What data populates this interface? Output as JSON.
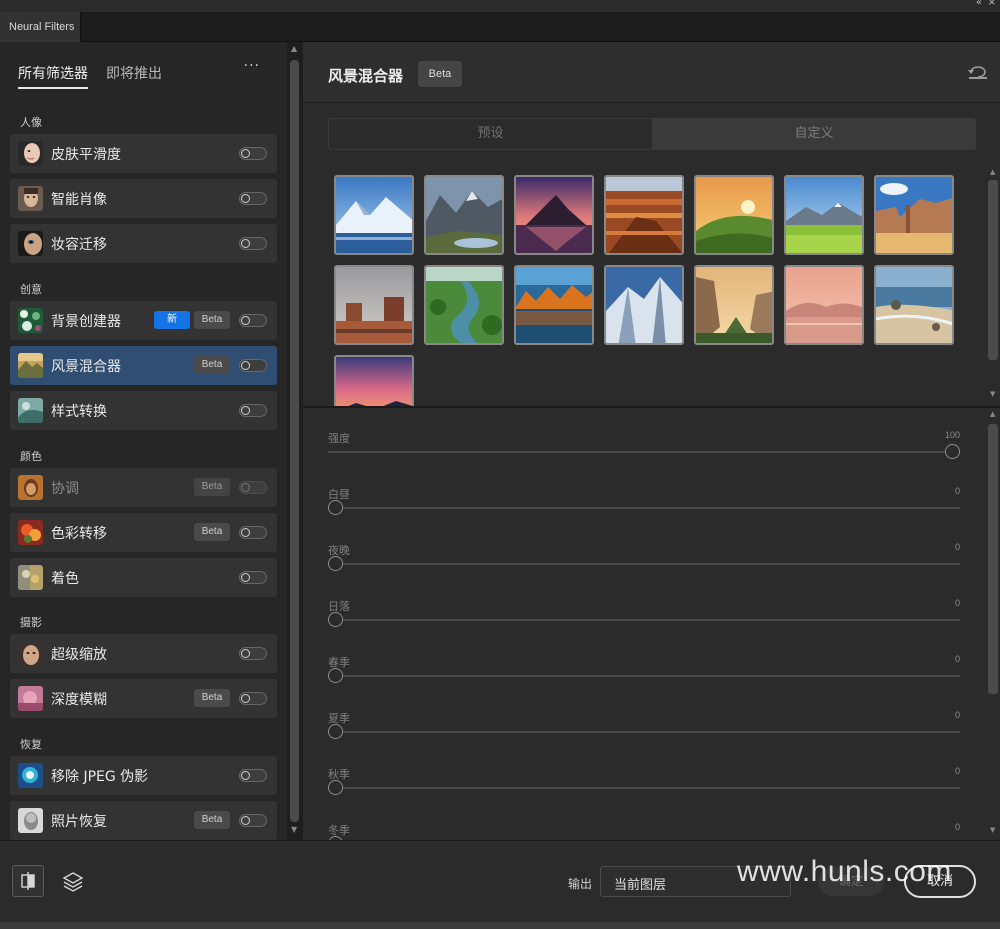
{
  "window": {
    "tab_title": "Neural Filters",
    "collapse_glyph": "«",
    "close_glyph": "×"
  },
  "left": {
    "tabs": [
      {
        "label": "所有筛选器"
      },
      {
        "label": "即将推出"
      }
    ],
    "more_glyph": "···",
    "sections": [
      {
        "label": "人像"
      },
      {
        "label": "创意"
      },
      {
        "label": "颜色"
      },
      {
        "label": "摄影"
      },
      {
        "label": "恢复"
      }
    ],
    "items": [
      {
        "label": "皮肤平滑度"
      },
      {
        "label": "智能肖像"
      },
      {
        "label": "妆容迁移"
      },
      {
        "label": "背景创建器",
        "new_badge": "新",
        "beta_badge": "Beta"
      },
      {
        "label": "风景混合器",
        "beta_badge": "Beta"
      },
      {
        "label": "样式转换"
      },
      {
        "label": "协调",
        "beta_badge": "Beta"
      },
      {
        "label": "色彩转移",
        "beta_badge": "Beta"
      },
      {
        "label": "着色"
      },
      {
        "label": "超级缩放"
      },
      {
        "label": "深度模糊",
        "beta_badge": "Beta"
      },
      {
        "label": "移除 JPEG 伪影"
      },
      {
        "label": "照片恢复",
        "beta_badge": "Beta"
      }
    ]
  },
  "right": {
    "title": "风景混合器",
    "beta": "Beta",
    "segments": [
      {
        "label": "预设"
      },
      {
        "label": "自定义"
      }
    ],
    "sliders": [
      {
        "label": "强度",
        "value": "100",
        "level": 100
      },
      {
        "label": "白昼",
        "value": "0",
        "level": 0
      },
      {
        "label": "夜晚",
        "value": "0",
        "level": 0
      },
      {
        "label": "日落",
        "value": "0",
        "level": 0
      },
      {
        "label": "春季",
        "value": "0",
        "level": 0
      },
      {
        "label": "夏季",
        "value": "0",
        "level": 0
      },
      {
        "label": "秋季",
        "value": "0",
        "level": 0
      },
      {
        "label": "冬季",
        "value": "0",
        "level": 0
      }
    ]
  },
  "footer": {
    "output_label": "输出",
    "output_value": "当前图层",
    "ok_label": "确定",
    "cancel_label": "取消",
    "watermark": "www.hunls.com"
  }
}
